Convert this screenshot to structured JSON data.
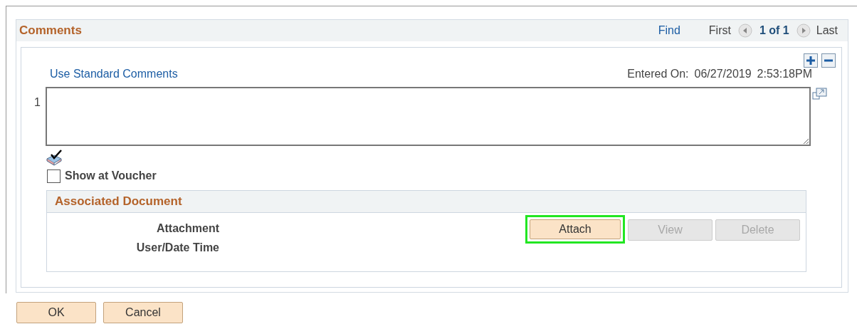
{
  "panel": {
    "title": "Comments",
    "nav": {
      "find": "Find",
      "first": "First",
      "count": "1 of 1",
      "last": "Last"
    }
  },
  "row": {
    "number": "1",
    "standard_comments_link": "Use Standard Comments",
    "entered_on_label": "Entered On:",
    "entered_on_date": "06/27/2019",
    "entered_on_time": "2:53:18PM",
    "show_at_voucher": {
      "label": "Show at Voucher",
      "checked": false
    }
  },
  "associated_document": {
    "title": "Associated Document",
    "labels": [
      "Attachment",
      "User/Date Time"
    ],
    "buttons": [
      {
        "label": "Attach",
        "disabled": false,
        "highlighted": true
      },
      {
        "label": "View",
        "disabled": true,
        "highlighted": false
      },
      {
        "label": "Delete",
        "disabled": true,
        "highlighted": false
      }
    ]
  },
  "footer_buttons": [
    "OK",
    "Cancel"
  ]
}
